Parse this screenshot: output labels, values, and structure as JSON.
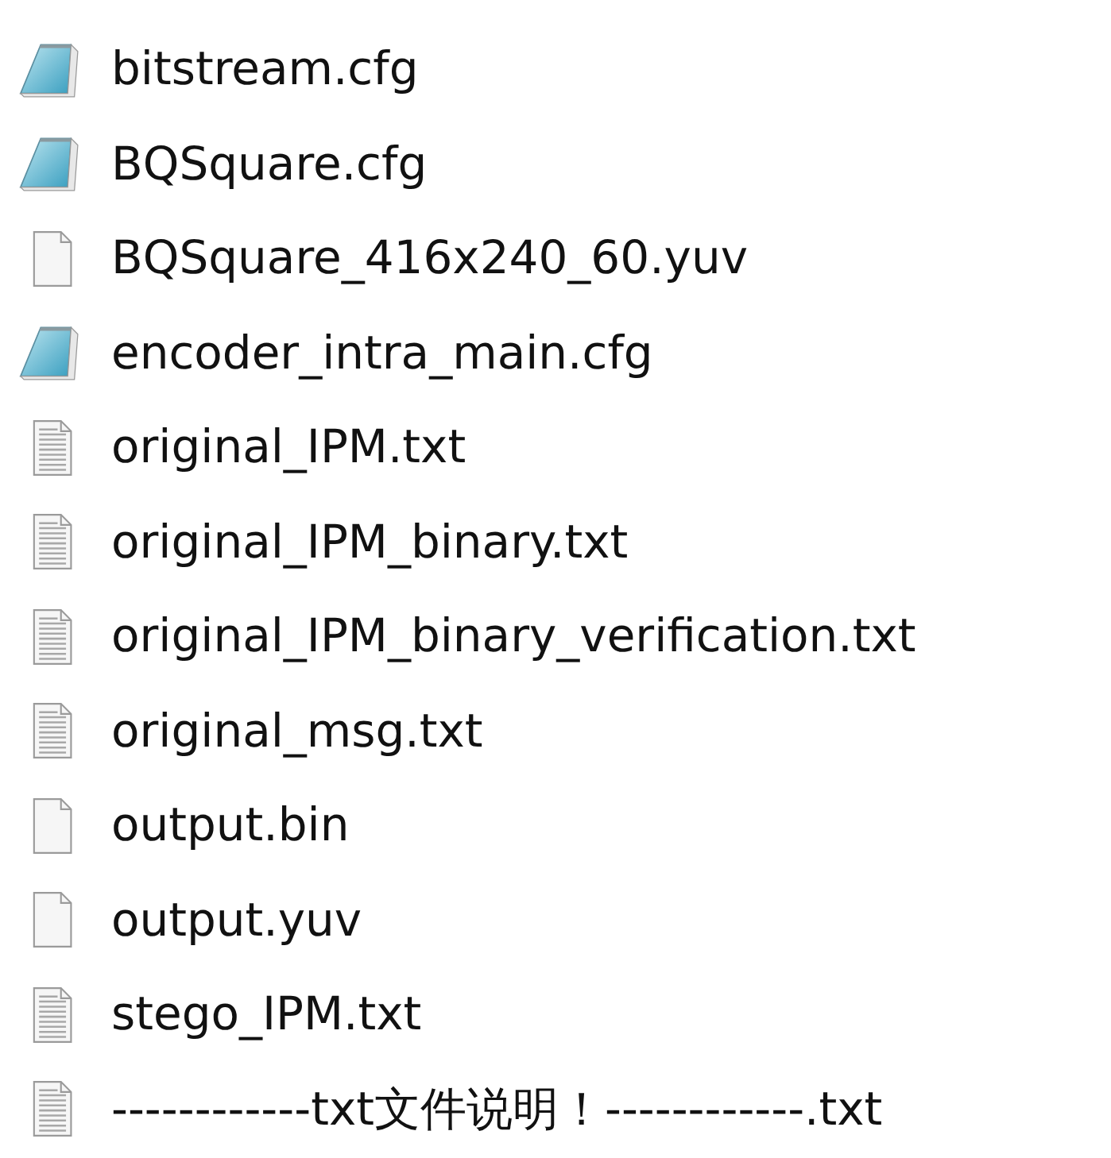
{
  "files": [
    {
      "name": "bitstream.cfg",
      "kind": "notepad"
    },
    {
      "name": "BQSquare.cfg",
      "kind": "notepad"
    },
    {
      "name": "BQSquare_416x240_60.yuv",
      "kind": "blank"
    },
    {
      "name": "encoder_intra_main.cfg",
      "kind": "notepad"
    },
    {
      "name": "original_IPM.txt",
      "kind": "text"
    },
    {
      "name": "original_IPM_binary.txt",
      "kind": "text"
    },
    {
      "name": "original_IPM_binary_verification.txt",
      "kind": "text"
    },
    {
      "name": "original_msg.txt",
      "kind": "text"
    },
    {
      "name": "output.bin",
      "kind": "blank"
    },
    {
      "name": "output.yuv",
      "kind": "blank"
    },
    {
      "name": "stego_IPM.txt",
      "kind": "text"
    },
    {
      "name": "------------txt文件说明！------------.txt",
      "kind": "text"
    }
  ]
}
